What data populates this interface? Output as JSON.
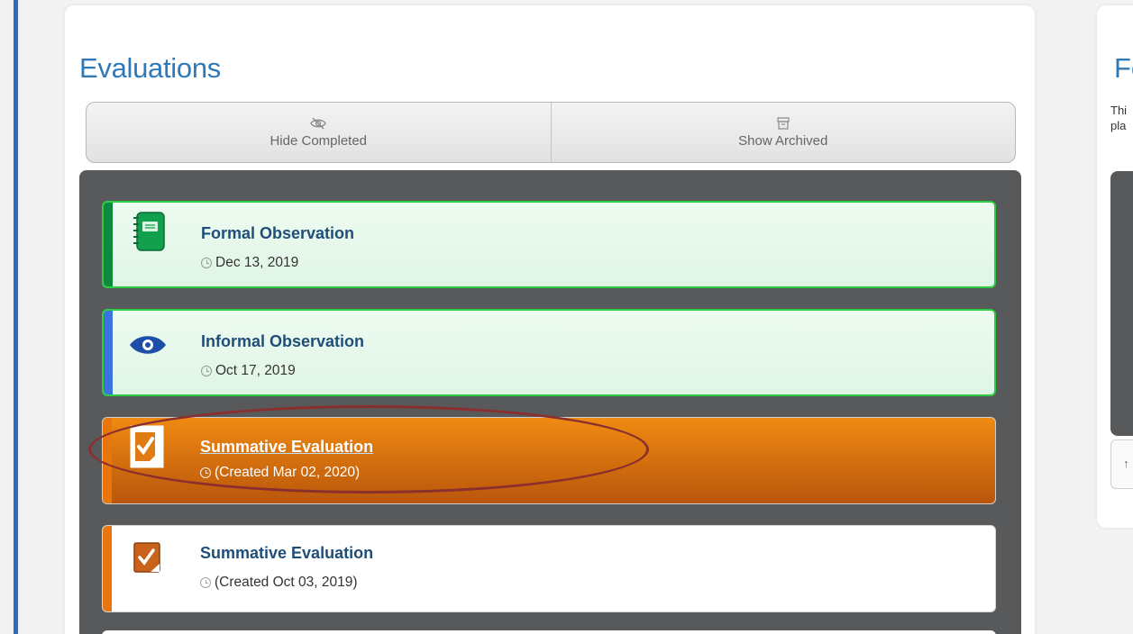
{
  "panel": {
    "title": "Evaluations"
  },
  "toolbar": {
    "hide_completed_label": "Hide Completed",
    "show_archived_label": "Show Archived"
  },
  "cards": [
    {
      "title": "Formal Observation",
      "date": "Dec 13, 2019",
      "icon": "notebook-icon",
      "stripe_color": "#0d8a3f",
      "status": "green"
    },
    {
      "title": "Informal Observation",
      "date": "Oct 17, 2019",
      "icon": "eye-icon",
      "stripe_color": "#3b73e0",
      "status": "green"
    },
    {
      "title": "Summative Evaluation",
      "date": "(Created Mar 02, 2020)",
      "icon": "checklist-icon",
      "stripe_color": "#e9760c",
      "status": "selected"
    },
    {
      "title": "Summative Evaluation",
      "date": "(Created Oct 03, 2019)",
      "icon": "checklist-icon",
      "stripe_color": "#e9760c",
      "status": "default"
    }
  ],
  "right_panel": {
    "title": "Fe",
    "text_line1": "Thi",
    "text_line2": "pla",
    "button_label": "↑"
  },
  "colors": {
    "accent": "#2e7ab8",
    "left_bar": "#2e6bbf",
    "list_bg": "#58595b",
    "annotation": "#8b2e2e"
  }
}
